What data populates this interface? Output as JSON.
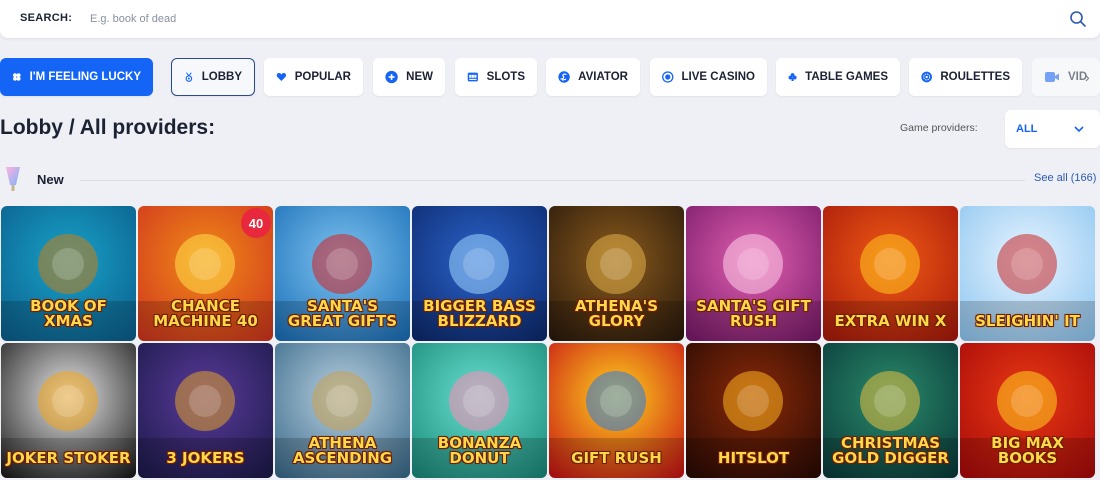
{
  "search": {
    "label": "SEARCH:",
    "placeholder": "E.g. book of dead"
  },
  "categories": [
    {
      "label": "I'M FEELING LUCKY",
      "icon": "clover-icon"
    },
    {
      "label": "LOBBY",
      "icon": "medal-icon"
    },
    {
      "label": "POPULAR",
      "icon": "heart-icon"
    },
    {
      "label": "NEW",
      "icon": "plus-circle-icon"
    },
    {
      "label": "SLOTS",
      "icon": "slot-machine-icon"
    },
    {
      "label": "AVIATOR",
      "icon": "aviator-icon"
    },
    {
      "label": "LIVE CASINO",
      "icon": "live-dot-icon"
    },
    {
      "label": "TABLE GAMES",
      "icon": "club-suit-icon"
    },
    {
      "label": "ROULETTES",
      "icon": "roulette-icon"
    },
    {
      "label": "VID",
      "icon": "video-icon"
    }
  ],
  "page": {
    "title": "Lobby / All providers:",
    "providers_label": "Game providers:",
    "providers_value": "ALL"
  },
  "section": {
    "title": "New",
    "see_all": "See all (166)"
  },
  "games": [
    {
      "title": "Book of Xmas",
      "badge": ""
    },
    {
      "title": "Chance machine 40",
      "badge": "40"
    },
    {
      "title": "Santa's Great Gifts",
      "badge": ""
    },
    {
      "title": "Bigger Bass Blizzard",
      "badge": ""
    },
    {
      "title": "Athena's Glory",
      "badge": ""
    },
    {
      "title": "Santa's Gift Rush",
      "badge": ""
    },
    {
      "title": "Extra Win X",
      "badge": ""
    },
    {
      "title": "Sleighin' it",
      "badge": ""
    },
    {
      "title": "Joker Stoker",
      "badge": ""
    },
    {
      "title": "3 Jokers",
      "badge": ""
    },
    {
      "title": "Athena Ascending",
      "badge": ""
    },
    {
      "title": "Bonanza Donut",
      "badge": ""
    },
    {
      "title": "Gift Rush",
      "badge": ""
    },
    {
      "title": "Hitslot",
      "badge": ""
    },
    {
      "title": "Christmas Gold Digger",
      "badge": ""
    },
    {
      "title": "Big Max Books",
      "badge": ""
    }
  ],
  "colors": {
    "accent": "#1464f6",
    "link": "#2d5ab4",
    "badge": "#e8283c",
    "background": "#eef0f6"
  }
}
